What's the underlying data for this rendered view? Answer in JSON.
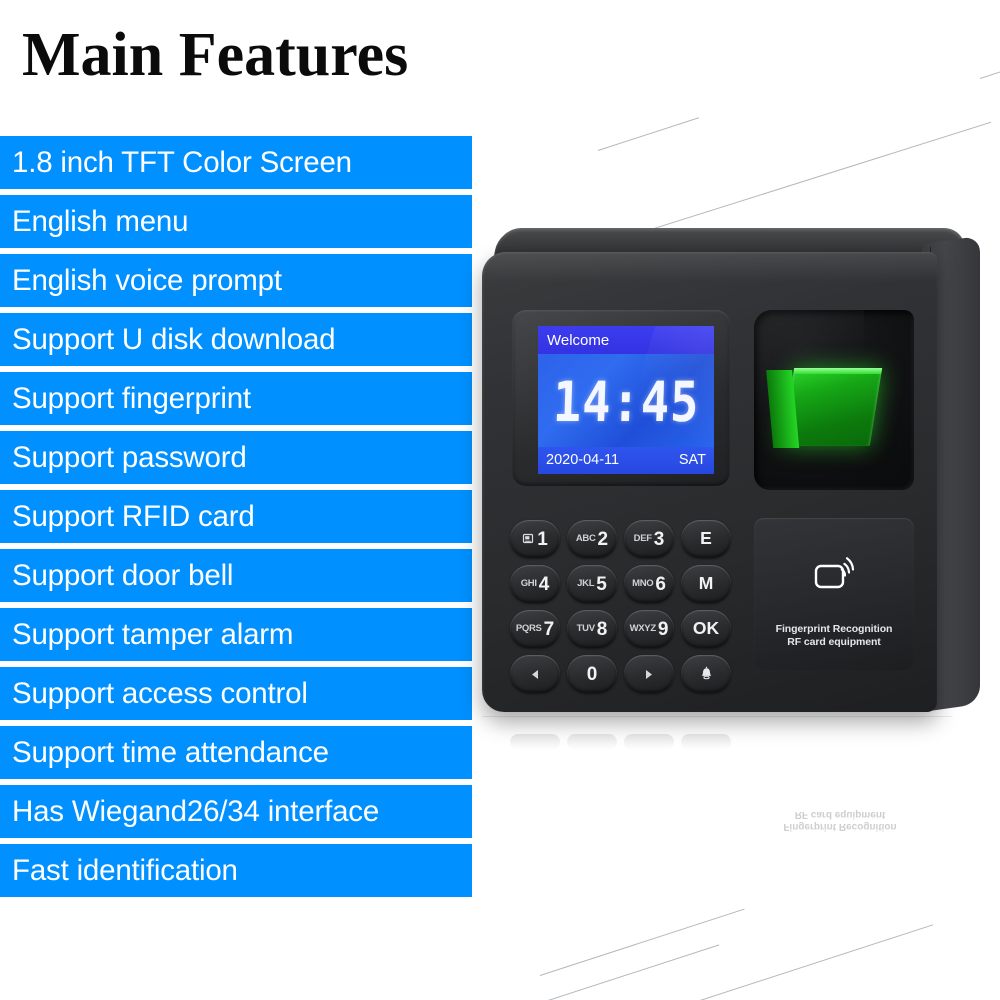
{
  "title": "Main Features",
  "features": [
    "1.8 inch TFT Color Screen",
    "English menu",
    "English voice prompt",
    "Support U disk download",
    "Support fingerprint",
    "Support password",
    "Support RFID card",
    "Support door bell",
    "Support tamper alarm",
    "Support access control",
    "Support time attendance",
    "Has Wiegand26/34 interface",
    "Fast identification"
  ],
  "device": {
    "screen": {
      "status": "Welcome",
      "time": "14:45",
      "date": "2020-04-11",
      "weekday": "SAT"
    },
    "keypad": [
      {
        "letters": "",
        "digit": "1",
        "icon": "id-card-icon"
      },
      {
        "letters": "ABC",
        "digit": "2",
        "icon": ""
      },
      {
        "letters": "DEF",
        "digit": "3",
        "icon": ""
      },
      {
        "letters": "",
        "digit": "E",
        "icon": ""
      },
      {
        "letters": "GHI",
        "digit": "4",
        "icon": ""
      },
      {
        "letters": "JKL",
        "digit": "5",
        "icon": ""
      },
      {
        "letters": "MNO",
        "digit": "6",
        "icon": ""
      },
      {
        "letters": "",
        "digit": "M",
        "icon": ""
      },
      {
        "letters": "PQRS",
        "digit": "7",
        "icon": ""
      },
      {
        "letters": "TUV",
        "digit": "8",
        "icon": ""
      },
      {
        "letters": "WXYZ",
        "digit": "9",
        "icon": ""
      },
      {
        "letters": "",
        "digit": "OK",
        "icon": ""
      },
      {
        "letters": "",
        "digit": "",
        "icon": "arrow-left-icon"
      },
      {
        "letters": "",
        "digit": "0",
        "icon": ""
      },
      {
        "letters": "",
        "digit": "",
        "icon": "arrow-right-icon"
      },
      {
        "letters": "",
        "digit": "",
        "icon": "door-bell-icon"
      }
    ],
    "rfid": {
      "icon": "rfid-card-icon",
      "caption_line1": "Fingerprint Recognition",
      "caption_line2": "RF card equipment"
    }
  },
  "colors": {
    "feature_bar": "#0090ff",
    "feature_text": "#ffffff",
    "title_text": "#0b0b0b",
    "background": "#ffffff",
    "lcd_blue": "#2f6cf0",
    "fingerprint_green": "#16a716"
  }
}
